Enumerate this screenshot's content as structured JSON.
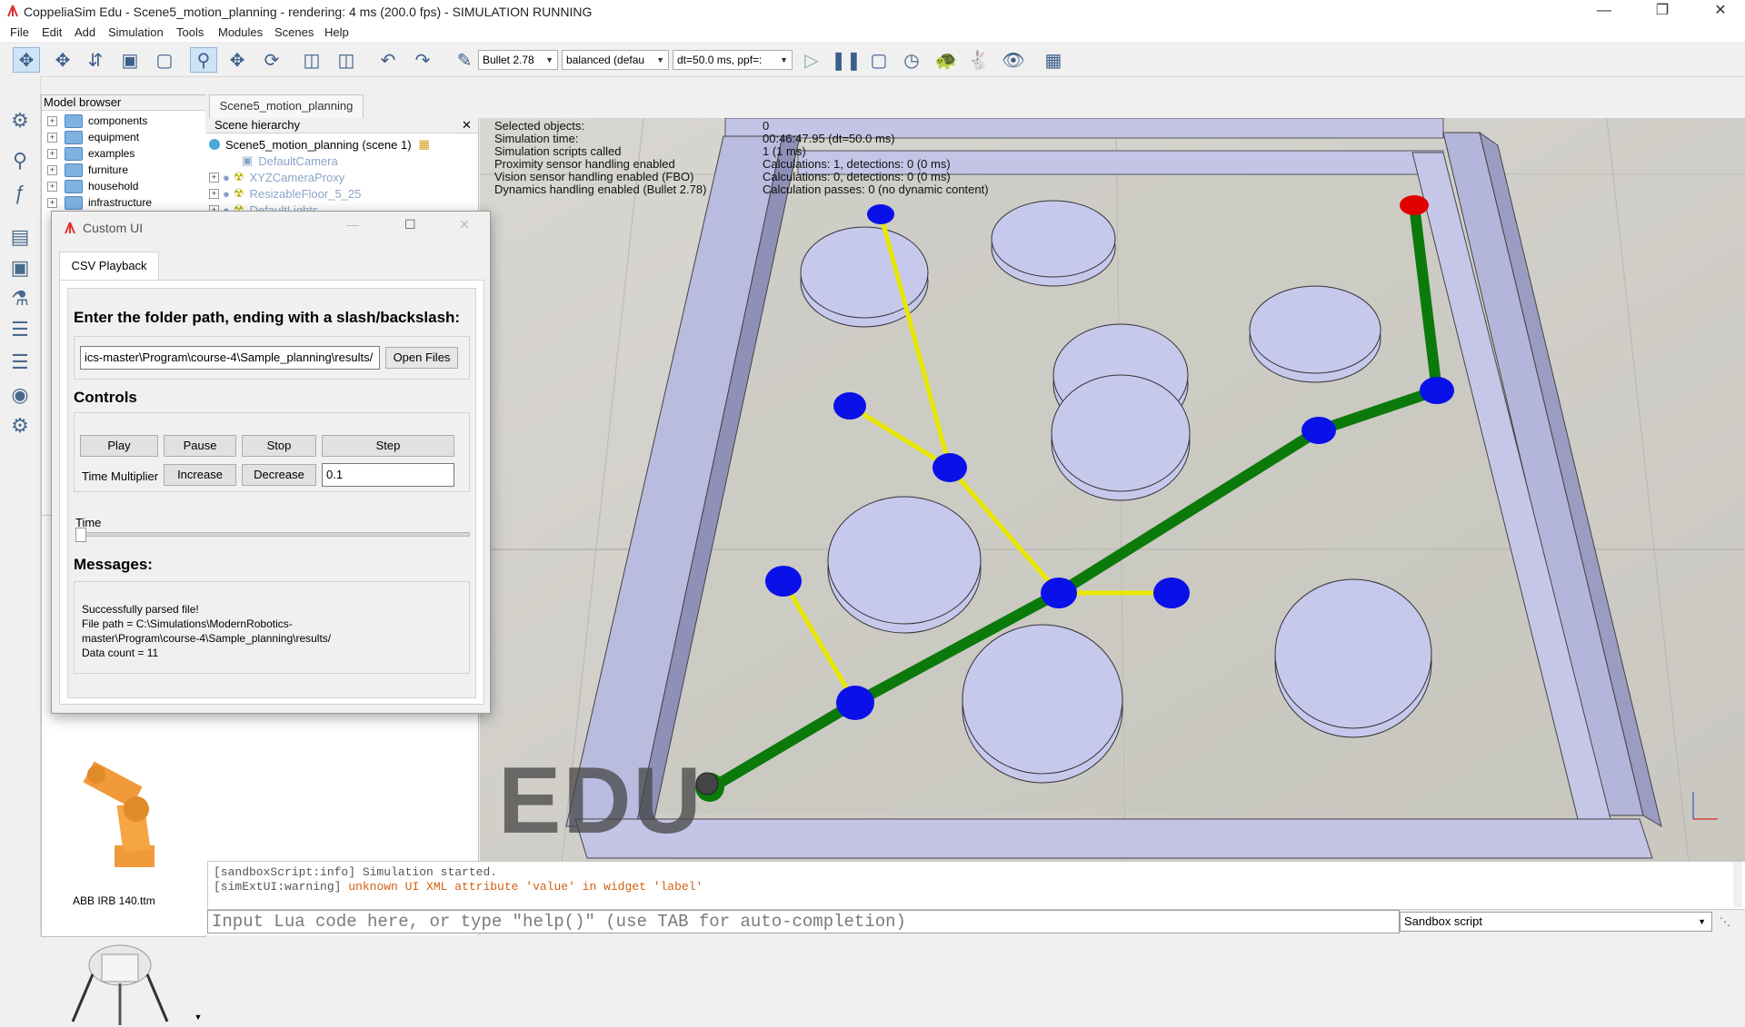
{
  "window": {
    "title": "CoppeliaSim Edu - Scene5_motion_planning - rendering: 4 ms (200.0 fps) - SIMULATION RUNNING"
  },
  "menu": [
    "File",
    "Edit",
    "Add",
    "Simulation",
    "Tools",
    "Modules",
    "Scenes",
    "Help"
  ],
  "toolbar": {
    "engine": "Bullet 2.78",
    "mode": "balanced (defau",
    "timestep": "dt=50.0 ms, ppf=:"
  },
  "model_browser": {
    "header": "Model browser",
    "items": [
      "components",
      "equipment",
      "examples",
      "furniture",
      "household",
      "infrastructure"
    ],
    "thumbnail_label": "ABB IRB 140.ttm"
  },
  "scene": {
    "tab": "Scene5_motion_planning",
    "hierarchy_header": "Scene hierarchy",
    "hierarchy_items": [
      "Scene5_motion_planning (scene 1)",
      "DefaultCamera",
      "XYZCameraProxy",
      "ResizableFloor_5_25",
      "DefaultLights"
    ]
  },
  "stats": {
    "labels": [
      "Selected objects:",
      "Simulation time:",
      "Simulation scripts called",
      "Proximity sensor handling enabled",
      "Vision sensor handling enabled (FBO)",
      "Dynamics handling enabled (Bullet 2.78)"
    ],
    "values": [
      "0",
      "00:46:47.95 (dt=50.0 ms)",
      "1 (1 ms)",
      "Calculations: 1, detections: 0 (0 ms)",
      "Calculations: 0, detections: 0 (0 ms)",
      "Calculation passes: 0 (no dynamic content)"
    ]
  },
  "custom_ui": {
    "title": "Custom UI",
    "tab": "CSV Playback",
    "folder_prompt": "Enter the folder path, ending with a slash/backslash:",
    "folder_value": "ics-master\\Program\\course-4\\Sample_planning\\results/",
    "open_files": "Open Files",
    "controls_header": "Controls",
    "play": "Play",
    "pause": "Pause",
    "stop": "Stop",
    "step": "Step",
    "time_multiplier_label": "Time Multiplier",
    "increase": "Increase",
    "decrease": "Decrease",
    "multiplier_value": "0.1",
    "time_label": "Time",
    "time_slider_value": 0.0,
    "messages_header": "Messages:",
    "messages": [
      "Successfully parsed file!",
      "File path = C:\\Simulations\\ModernRobotics-",
      "master\\Program\\course-4\\Sample_planning\\results/",
      "Data count = 11"
    ]
  },
  "console": {
    "line1": "[sandboxScript:info] Simulation started.",
    "line2_prefix": "[simExtUI:warning] ",
    "line2_msg": "unknown UI XML attribute 'value' in widget 'label'",
    "input_placeholder": "Input Lua code here, or type \"help()\" (use TAB for auto-completion)",
    "script_selector": "Sandbox script"
  },
  "viewport": {
    "watermark": "EDU"
  },
  "colors": {
    "path_green": "#0b7a0b",
    "tree_yellow": "#eaea00",
    "node_blue": "#0a10e8",
    "goal_red": "#e00000",
    "obstacle": "#c6c8ec"
  }
}
